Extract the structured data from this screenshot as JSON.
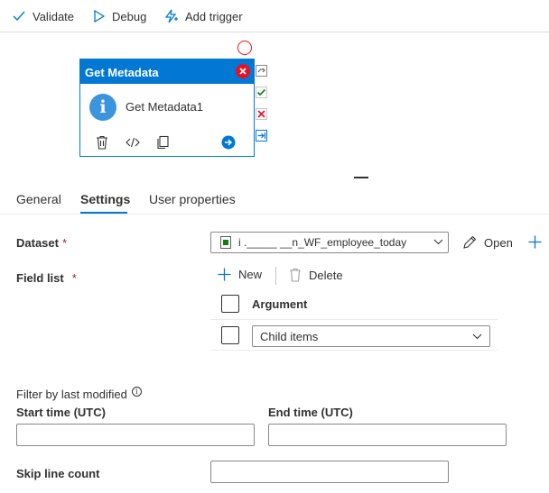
{
  "toolbar": {
    "validate_label": "Validate",
    "debug_label": "Debug",
    "add_trigger_label": "Add trigger"
  },
  "activity": {
    "type_title": "Get Metadata",
    "name": "Get Metadata1",
    "header_color": "#0078d4",
    "info_icon_glyph": "i"
  },
  "tabs": [
    {
      "label": "General"
    },
    {
      "label": "Settings"
    },
    {
      "label": "User properties"
    }
  ],
  "active_tab": "Settings",
  "settings": {
    "dataset_label": "Dataset",
    "dataset_value": "i    ._____      __n_WF_employee_today",
    "open_label": "Open",
    "field_list_label": "Field list",
    "required_marker": "*",
    "new_label": "New",
    "delete_label": "Delete",
    "argument_header": "Argument",
    "argument_rows": [
      {
        "value": "Child items"
      }
    ],
    "filter_title": "Filter by last modified",
    "info_glyph": "i",
    "start_time_label": "Start time (UTC)",
    "start_time_value": "",
    "end_time_label": "End time (UTC)",
    "end_time_value": "",
    "skip_line_label": "Skip line count",
    "skip_line_value": ""
  },
  "colors": {
    "accent": "#0078d4",
    "error": "#e81123",
    "success": "#107c10",
    "required": "#a4262c"
  }
}
